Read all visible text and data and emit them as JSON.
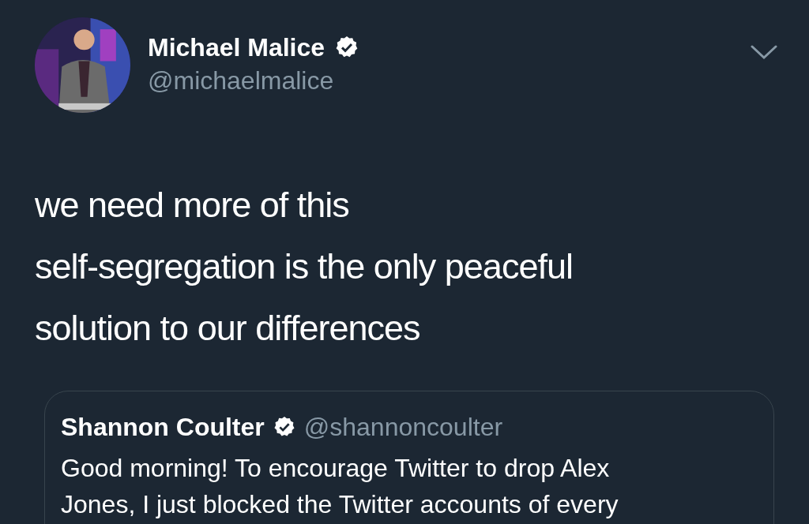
{
  "author": {
    "name": "Michael Malice",
    "verified": true,
    "handle": "@michaelmalice"
  },
  "tweet": {
    "lines": [
      "we need more of this",
      "self-segregation is the only peaceful",
      "solution to our differences"
    ]
  },
  "quoted_tweet": {
    "name": "Shannon Coulter",
    "verified": true,
    "handle": "@shannoncoulter",
    "lines": [
      "Good morning! To encourage Twitter to drop Alex",
      "Jones, I just blocked the Twitter accounts of every"
    ]
  }
}
